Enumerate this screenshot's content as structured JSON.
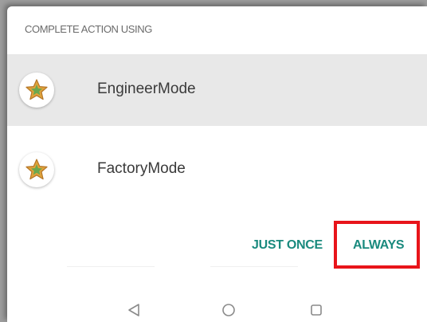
{
  "dialog": {
    "title": "COMPLETE ACTION USING"
  },
  "apps": [
    {
      "label": "EngineerMode",
      "icon": "star-badge-icon",
      "selected": true
    },
    {
      "label": "FactoryMode",
      "icon": "star-badge-icon",
      "selected": false
    }
  ],
  "actions": {
    "just_once_label": "JUST ONCE",
    "always_label": "ALWAYS"
  },
  "navbar": {
    "back": "back-triangle-icon",
    "home": "home-circle-icon",
    "recents": "recents-square-icon"
  },
  "colors": {
    "accent": "#1a8a7e",
    "selected_row": "#e8e8e8",
    "highlight": "#e8141a",
    "star_fill": "#e0a23a",
    "star_center": "#6aa84f"
  }
}
